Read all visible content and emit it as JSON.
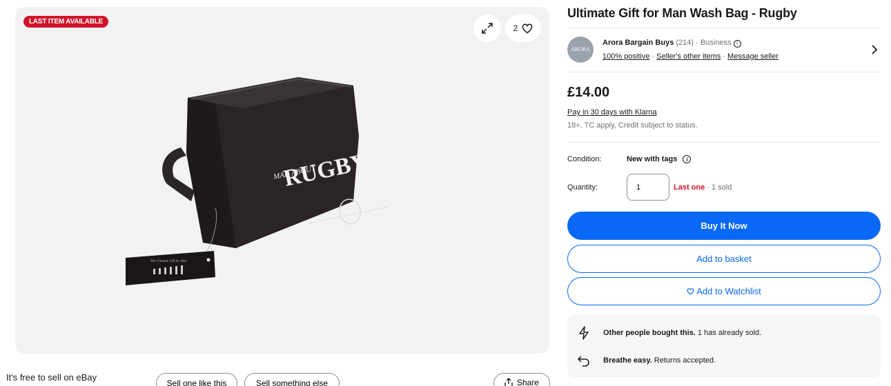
{
  "gallery": {
    "badge": "LAST ITEM AVAILABLE",
    "watch_count": "2",
    "image_text_1": "MAD ABOUT",
    "image_text_2": "RUGBY"
  },
  "footer": {
    "free_sell": "It's free to sell on eBay",
    "sell_one_like": "Sell one like this",
    "sell_something": "Sell something else",
    "share": "Share"
  },
  "item": {
    "title": "Ultimate Gift for Man Wash Bag - Rugby",
    "price": "£14.00",
    "klarna": "Pay in 30 days with Klarna",
    "credit_note": "18+, TC apply, Credit subject to status."
  },
  "seller": {
    "logo_text": "ARORA",
    "name": "Arora Bargain Buys",
    "feedback_count": "(214)",
    "type": "· Business",
    "positive": "100% positive",
    "other_items": "Seller's other items",
    "message": "Message seller"
  },
  "details": {
    "condition_label": "Condition:",
    "condition_value": "New with tags",
    "quantity_label": "Quantity:",
    "quantity_value": "1",
    "last_one": "Last one",
    "sold": " · 1 sold"
  },
  "actions": {
    "buy_now": "Buy It Now",
    "add_basket": "Add to basket",
    "add_watchlist": "Add to Watchlist"
  },
  "info": {
    "row1_bold": "Other people bought this.",
    "row1_text": " 1 has already sold.",
    "row2_bold": "Breathe easy.",
    "row2_text": " Returns accepted."
  },
  "colors": {
    "accent": "#0968f6",
    "badge": "#d0142a"
  }
}
